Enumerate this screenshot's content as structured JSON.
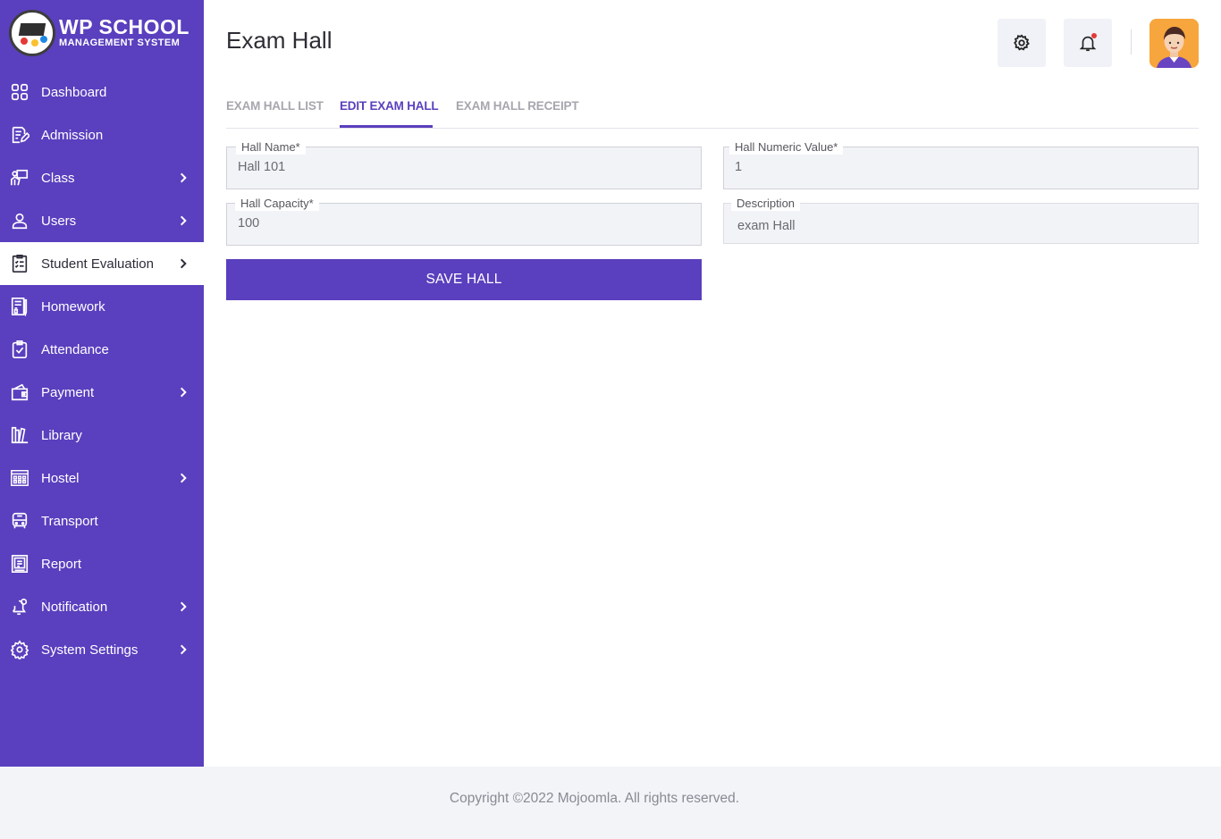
{
  "brand": {
    "title": "WP SCHOOL",
    "subtitle": "MANAGEMENT SYSTEM"
  },
  "sidebar": {
    "items": [
      {
        "label": "Dashboard",
        "icon": "dashboard-icon",
        "has_submenu": false
      },
      {
        "label": "Admission",
        "icon": "admission-icon",
        "has_submenu": false
      },
      {
        "label": "Class",
        "icon": "class-icon",
        "has_submenu": true
      },
      {
        "label": "Users",
        "icon": "user-icon",
        "has_submenu": true
      },
      {
        "label": "Student Evaluation",
        "icon": "evaluation-icon",
        "has_submenu": true,
        "active": true
      },
      {
        "label": "Homework",
        "icon": "homework-icon",
        "has_submenu": false
      },
      {
        "label": "Attendance",
        "icon": "attendance-icon",
        "has_submenu": false
      },
      {
        "label": "Payment",
        "icon": "wallet-icon",
        "has_submenu": true
      },
      {
        "label": "Library",
        "icon": "library-icon",
        "has_submenu": false
      },
      {
        "label": "Hostel",
        "icon": "hostel-icon",
        "has_submenu": true
      },
      {
        "label": "Transport",
        "icon": "bus-icon",
        "has_submenu": false
      },
      {
        "label": "Report",
        "icon": "report-icon",
        "has_submenu": false
      },
      {
        "label": "Notification",
        "icon": "notification-icon",
        "has_submenu": true
      },
      {
        "label": "System Settings",
        "icon": "settings-icon",
        "has_submenu": true
      }
    ]
  },
  "header": {
    "title": "Exam Hall",
    "settings_icon": "gear-icon",
    "notification_icon": "bell-icon",
    "avatar_icon": "user-avatar"
  },
  "tabs": [
    {
      "label": "EXAM HALL LIST",
      "active": false
    },
    {
      "label": "EDIT EXAM HALL",
      "active": true
    },
    {
      "label": "EXAM HALL RECEIPT",
      "active": false
    }
  ],
  "form": {
    "hall_name": {
      "label": "Hall Name*",
      "value": "Hall 101"
    },
    "hall_numeric_value": {
      "label": "Hall Numeric Value*",
      "value": "1"
    },
    "hall_capacity": {
      "label": "Hall Capacity*",
      "value": "100"
    },
    "description": {
      "label": "Description",
      "value": "exam Hall"
    },
    "save_label": "SAVE HALL"
  },
  "footer": {
    "text": "Copyright ©2022 Mojoomla. All rights reserved."
  },
  "colors": {
    "primary": "#5a3fbe",
    "field_bg": "#f1f3f7",
    "footer_bg": "#f2f4f8"
  }
}
